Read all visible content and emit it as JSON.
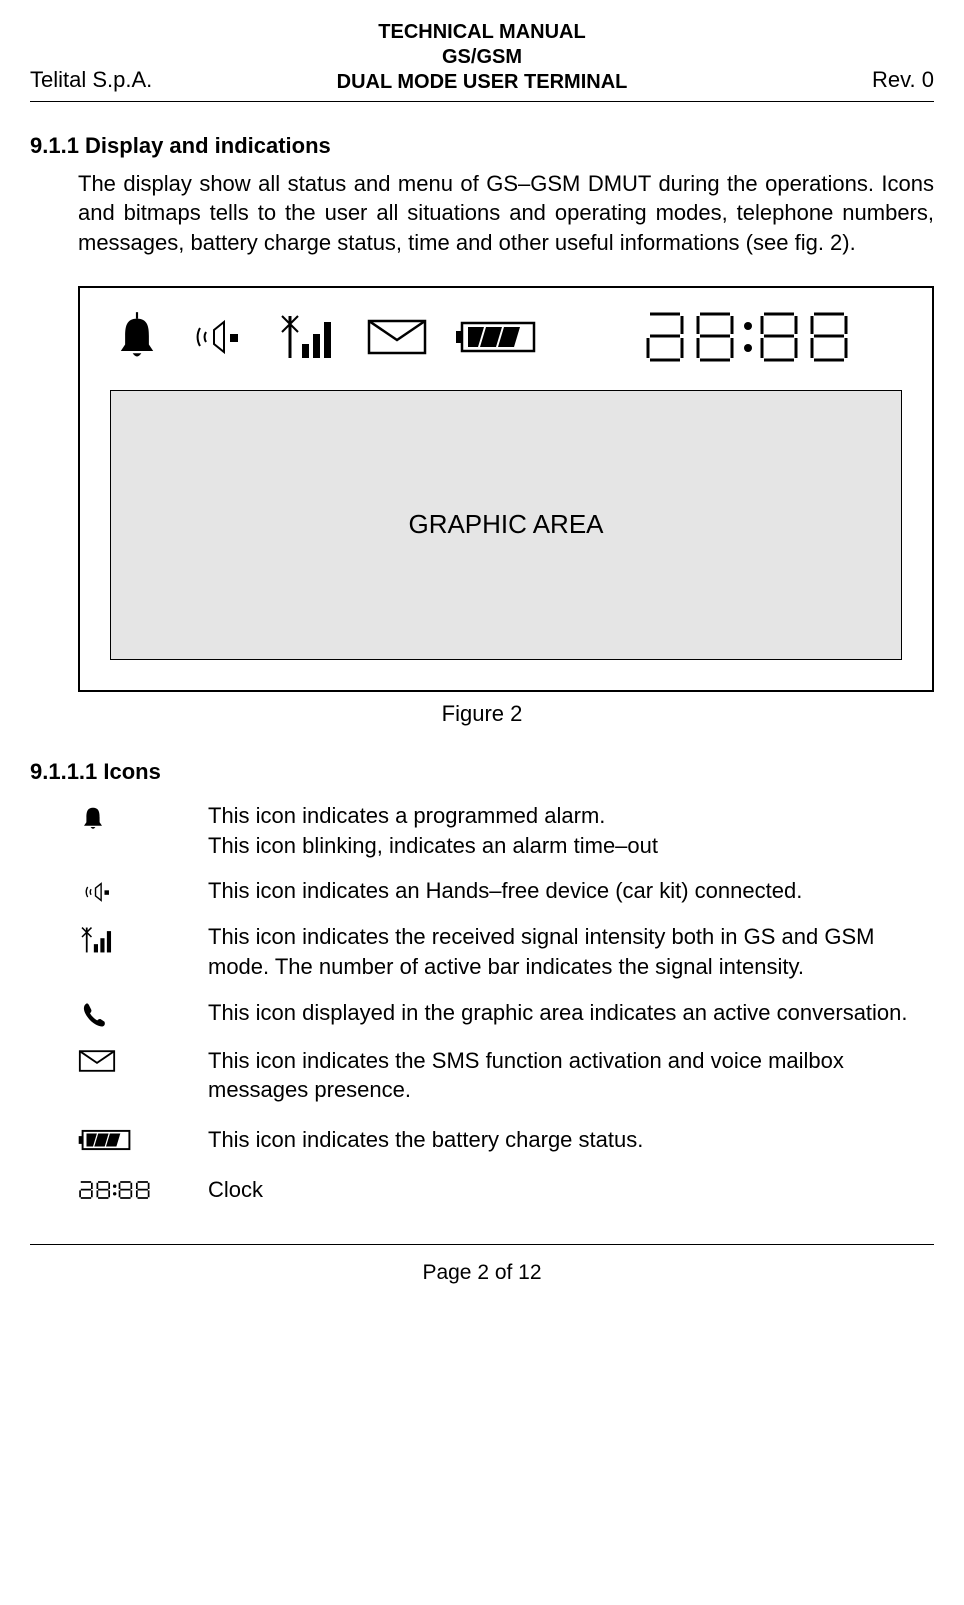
{
  "header": {
    "left": "Telital S.p.A.",
    "line1": "TECHNICAL MANUAL",
    "line2": "GS/GSM",
    "line3": "DUAL MODE USER TERMINAL",
    "right": "Rev. 0"
  },
  "section": {
    "num_title": "9.1.1 Display and indications",
    "para": "The display show all status and menu of GS–GSM DMUT during the operations. Icons and bitmaps tells to the user all situations and operating modes, telephone numbers, messages, battery charge status, time and other useful informations (see fig. 2)."
  },
  "figure": {
    "graphic_label": "GRAPHIC AREA",
    "caption": "Figure 2"
  },
  "subsection": "9.1.1.1 Icons",
  "icons": {
    "alarm": {
      "line1": "This icon indicates a programmed alarm.",
      "line2": "This icon blinking, indicates an alarm time–out"
    },
    "handsfree": "This icon indicates an Hands–free device (car kit) connected.",
    "signal": "This icon indicates the received signal intensity both in GS and GSM mode. The number of active bar indicates the signal intensity.",
    "call": "This icon displayed in the graphic area indicates an active conversation.",
    "sms": "This icon indicates the SMS function activation and voice mailbox messages presence.",
    "battery": "This icon indicates the battery charge status.",
    "clock": "Clock"
  },
  "footer": "Page 2 of 12"
}
